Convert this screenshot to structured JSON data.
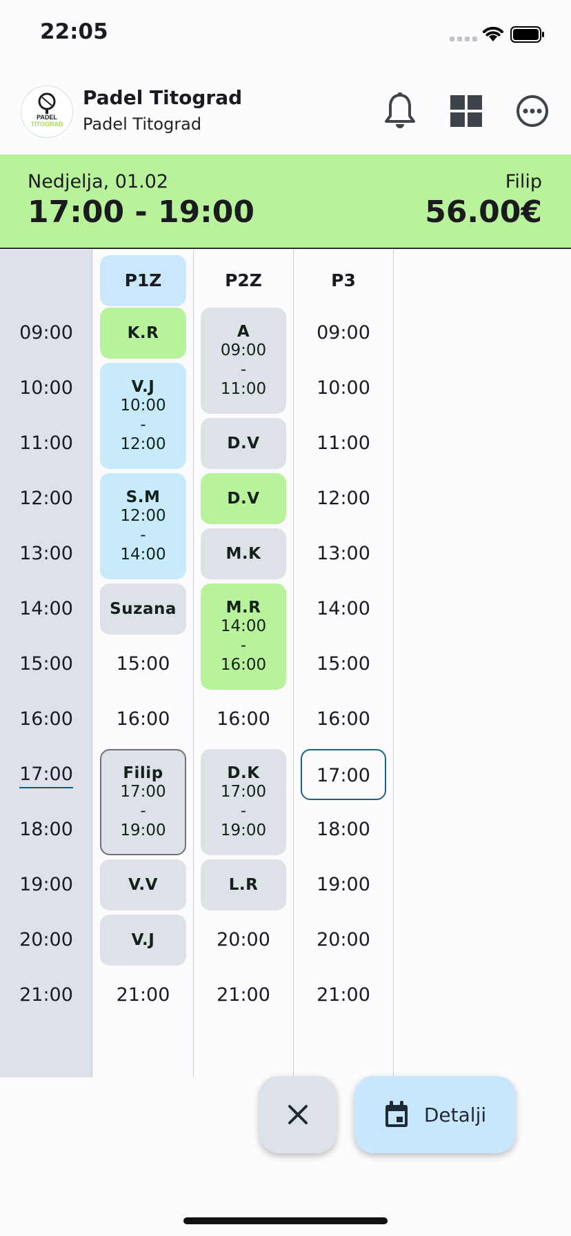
{
  "status_bar": {
    "time": "22:05"
  },
  "header": {
    "club_name": "Padel Titograd",
    "club_subtitle": "Padel Titograd",
    "logo_text_top": "PADEL",
    "logo_text_bottom": "TITOGRAD",
    "icons": [
      "bell-icon",
      "grid-icon",
      "more-icon"
    ]
  },
  "selection": {
    "date": "Nedjelja, 01.02",
    "time_range": "17:00 - 19:00",
    "player": "Filip",
    "price": "56.00€"
  },
  "schedule": {
    "hours": [
      "09:00",
      "10:00",
      "11:00",
      "12:00",
      "13:00",
      "14:00",
      "15:00",
      "16:00",
      "17:00",
      "18:00",
      "19:00",
      "20:00",
      "21:00"
    ],
    "current_hour": "17:00",
    "courts": [
      {
        "name": "P1Z",
        "slots": [
          {
            "type": "booking",
            "name": "K.R",
            "color": "green"
          },
          {
            "type": "booking",
            "name": "V.J",
            "start": "10:00",
            "sep": "-",
            "end": "12:00",
            "color": "blue"
          },
          {
            "type": "booking",
            "name": "S.M",
            "start": "12:00",
            "sep": "-",
            "end": "14:00",
            "color": "blue"
          },
          {
            "type": "booking",
            "name": "Suzana",
            "color": "gray"
          },
          {
            "type": "free",
            "label": "15:00"
          },
          {
            "type": "free",
            "label": "16:00"
          },
          {
            "type": "booking",
            "name": "Filip",
            "start": "17:00",
            "sep": "-",
            "end": "19:00",
            "color": "selected"
          },
          {
            "type": "booking",
            "name": "V.V",
            "color": "gray"
          },
          {
            "type": "booking",
            "name": "V.J",
            "color": "gray"
          },
          {
            "type": "free",
            "label": "21:00"
          }
        ]
      },
      {
        "name": "P2Z",
        "slots": [
          {
            "type": "booking",
            "name": "A",
            "start": "09:00",
            "sep": "-",
            "end": "11:00",
            "color": "gray"
          },
          {
            "type": "booking",
            "name": "D.V",
            "color": "gray"
          },
          {
            "type": "booking",
            "name": "D.V",
            "color": "green"
          },
          {
            "type": "booking",
            "name": "M.K",
            "color": "gray"
          },
          {
            "type": "booking",
            "name": "M.R",
            "start": "14:00",
            "sep": "-",
            "end": "16:00",
            "color": "green"
          },
          {
            "type": "free",
            "label": "16:00"
          },
          {
            "type": "booking",
            "name": "D.K",
            "start": "17:00",
            "sep": "-",
            "end": "19:00",
            "color": "gray"
          },
          {
            "type": "booking",
            "name": "L.R",
            "color": "gray"
          },
          {
            "type": "free",
            "label": "20:00"
          },
          {
            "type": "free",
            "label": "21:00"
          }
        ]
      },
      {
        "name": "P3",
        "slots": [
          {
            "type": "free",
            "label": "09:00"
          },
          {
            "type": "free",
            "label": "10:00"
          },
          {
            "type": "free",
            "label": "11:00"
          },
          {
            "type": "free",
            "label": "12:00"
          },
          {
            "type": "free",
            "label": "13:00"
          },
          {
            "type": "free",
            "label": "14:00"
          },
          {
            "type": "free",
            "label": "15:00"
          },
          {
            "type": "free",
            "label": "16:00"
          },
          {
            "type": "free",
            "label": "17:00",
            "selected": true
          },
          {
            "type": "free",
            "label": "18:00"
          },
          {
            "type": "free",
            "label": "19:00"
          },
          {
            "type": "free",
            "label": "20:00"
          },
          {
            "type": "free",
            "label": "21:00"
          }
        ]
      }
    ]
  },
  "actions": {
    "close_icon": "close-icon",
    "details_label": "Detalji",
    "details_icon": "calendar-icon"
  },
  "colors": {
    "green": "#b8f29a",
    "blue": "#c8ebfc",
    "gray": "#dde1e8",
    "accent": "#1a6281"
  }
}
